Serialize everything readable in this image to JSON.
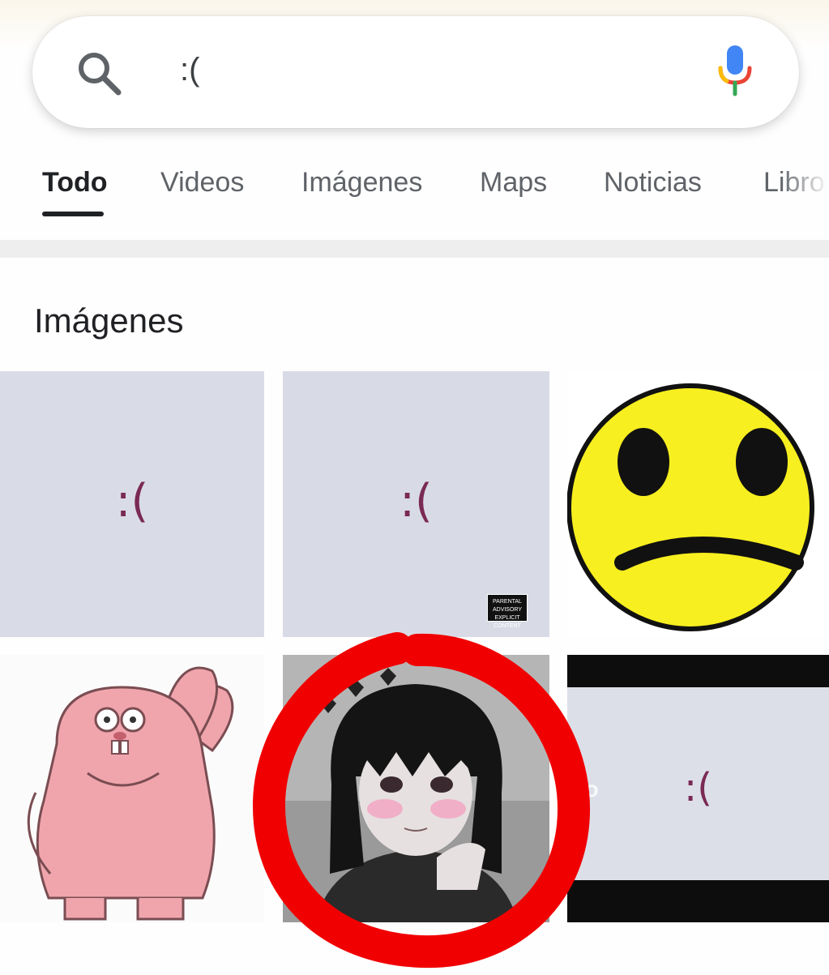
{
  "search": {
    "query": ":(",
    "search_icon": "search-icon",
    "mic_icon": "microphone-icon"
  },
  "tabs": [
    {
      "label": "Todo",
      "active": true
    },
    {
      "label": "Videos",
      "active": false
    },
    {
      "label": "Imágenes",
      "active": false
    },
    {
      "label": "Maps",
      "active": false
    },
    {
      "label": "Noticias",
      "active": false
    },
    {
      "label": "Libro",
      "active": false
    }
  ],
  "images_section": {
    "title": "Imágenes",
    "results": [
      {
        "kind": "album-cover",
        "face_text": ":("
      },
      {
        "kind": "album-cover-explicit",
        "face_text": ":(",
        "badge": "PARENTAL ADVISORY EXPLICIT CONTENT"
      },
      {
        "kind": "yellow-sad-smiley"
      },
      {
        "kind": "pink-cartoon-rabbit"
      },
      {
        "kind": "anime-girl-blushing",
        "highlighted": true
      },
      {
        "kind": "video-thumbnail",
        "face_text": ":(",
        "watermark": "vo"
      }
    ]
  },
  "colors": {
    "highlight_ring": "#f00000",
    "smiley_yellow": "#f7ef1f",
    "rabbit_pink": "#f0a5ad",
    "cover_bg": "#d8dbe6",
    "active_tab": "#202124"
  }
}
